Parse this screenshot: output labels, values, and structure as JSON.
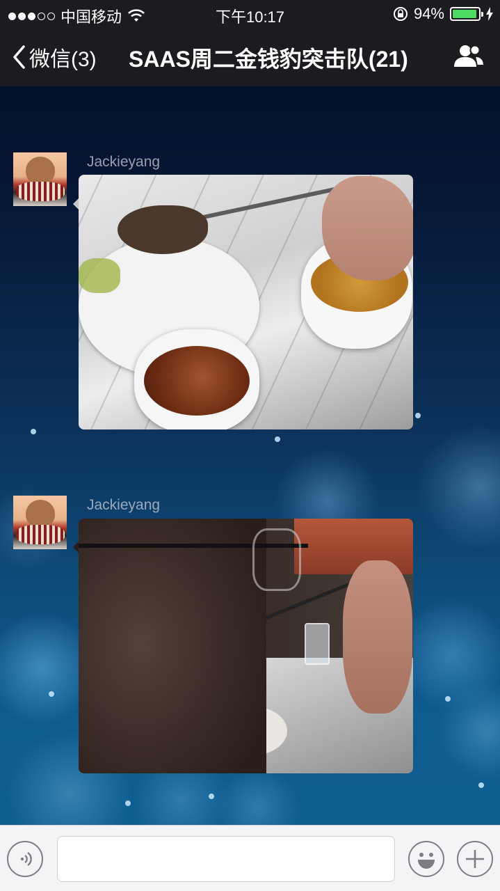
{
  "status_bar": {
    "carrier": "中国移动",
    "time": "下午10:17",
    "battery": "94%",
    "battery_level": 0.94
  },
  "nav": {
    "back_label": "微信(3)",
    "title": "SAAS周二金钱豹突击队(21)"
  },
  "messages": [
    {
      "sender": "Jackieyang",
      "type": "image"
    },
    {
      "sender": "Jackieyang",
      "type": "image"
    }
  ],
  "input_bar": {
    "value": "",
    "placeholder": ""
  },
  "colors": {
    "topbar": "#1c1c20",
    "battery_fill": "#4cd964",
    "input_bar": "#f4f4f6"
  },
  "icons": {
    "back": "chevron-left-icon",
    "group": "group-members-icon",
    "voice": "voice-icon",
    "emoji": "emoji-icon",
    "plus": "plus-icon"
  }
}
